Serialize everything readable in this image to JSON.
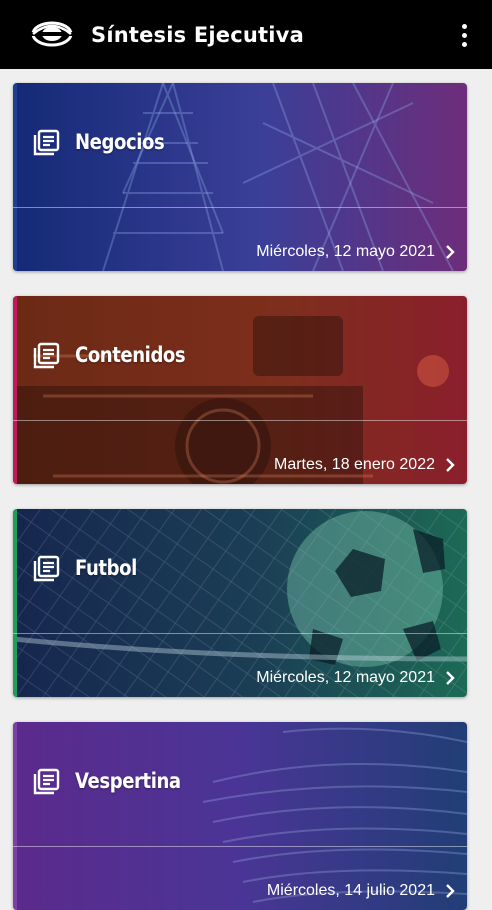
{
  "app": {
    "title": "Síntesis Ejecutiva",
    "logo_icon": "televisa-eye-logo",
    "menu_icon": "more-vert-icon"
  },
  "cards": [
    {
      "title": "Negocios",
      "date": "Miércoles, 12 mayo 2021",
      "accent": "#1d3f8f",
      "gradient": [
        "#142a76",
        "#3b3f98",
        "#6d2d7a"
      ]
    },
    {
      "title": "Contenidos",
      "date": "Martes, 18 enero 2022",
      "accent": "#c2185b",
      "gradient": [
        "#6b2a15",
        "#7e2e1c",
        "#8a1f2c"
      ]
    },
    {
      "title": "Futbol",
      "date": "Miércoles, 12 mayo 2021",
      "accent": "#1e9e5a",
      "gradient": [
        "#16264f",
        "#1b3f55",
        "#1c6a55"
      ]
    },
    {
      "title": "Vespertina",
      "date": "Miércoles, 14 julio 2021",
      "accent": "#7b3fa6",
      "gradient": [
        "#5b2a8c",
        "#4a3596",
        "#213e76"
      ]
    }
  ]
}
